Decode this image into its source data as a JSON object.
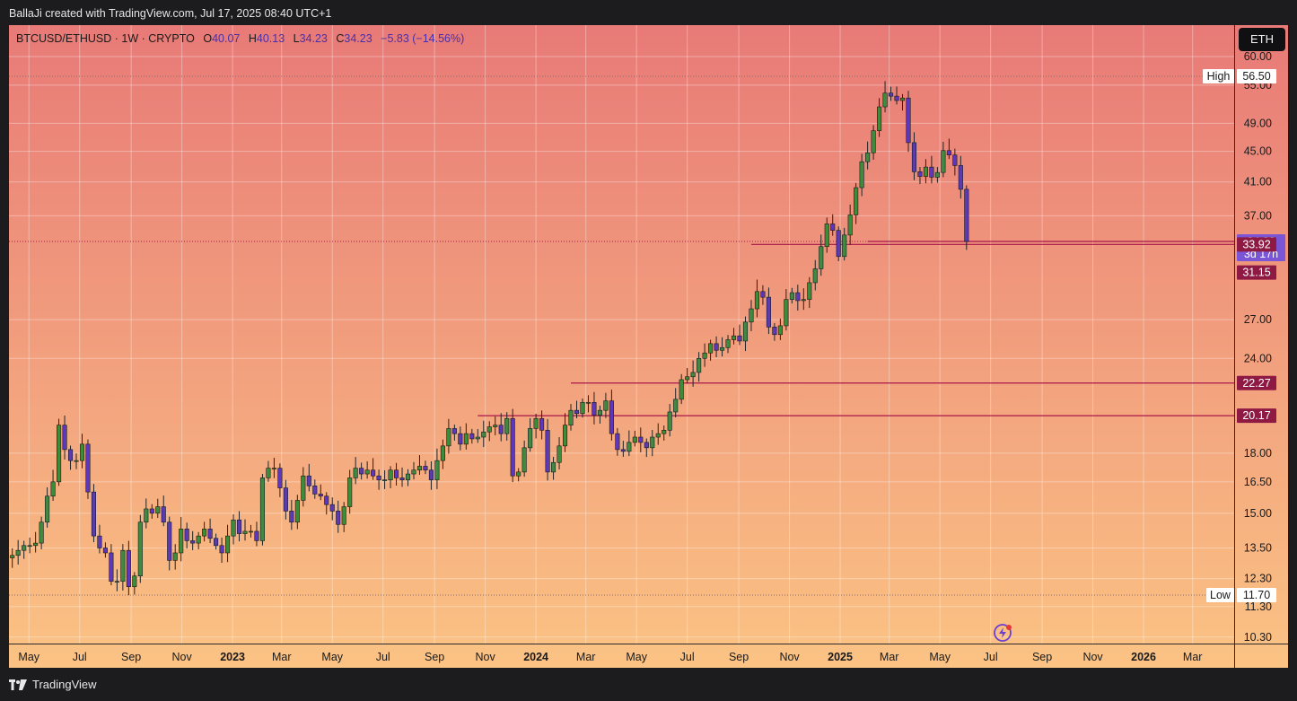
{
  "header": {
    "credit": "BallaJi created with TradingView.com, Jul 17, 2025 08:40 UTC+1"
  },
  "legend": {
    "symbol": "BTCUSD/ETHUSD · 1W · CRYPTO",
    "o_label": "O",
    "o_value": "40.07",
    "h_label": "H",
    "h_value": "40.13",
    "l_label": "L",
    "l_value": "34.23",
    "c_label": "C",
    "c_value": "34.23",
    "change": "−5.83 (−14.56%)"
  },
  "symbol_badge": "ETH",
  "footer": {
    "brand": "TradingView"
  },
  "colors": {
    "bg_top": "#e87a77",
    "bg_bottom": "#fbc384",
    "up": "#3e8b3e",
    "down": "#5d38b8",
    "level": "#a8164a",
    "price_label": "#7a56d6",
    "level_label": "#8e1a44"
  },
  "chart_data": {
    "type": "candlestick",
    "scale": "log",
    "ylim": [
      10.1,
      66
    ],
    "x_range": [
      "2022-04-07",
      "2026-04-20"
    ],
    "x_ticks": [
      {
        "date": "2022-05-01",
        "label": "May",
        "bold": false
      },
      {
        "date": "2022-07-01",
        "label": "Jul",
        "bold": false
      },
      {
        "date": "2022-09-01",
        "label": "Sep",
        "bold": false
      },
      {
        "date": "2022-11-01",
        "label": "Nov",
        "bold": false
      },
      {
        "date": "2023-01-01",
        "label": "2023",
        "bold": true
      },
      {
        "date": "2023-03-01",
        "label": "Mar",
        "bold": false
      },
      {
        "date": "2023-05-01",
        "label": "May",
        "bold": false
      },
      {
        "date": "2023-07-01",
        "label": "Jul",
        "bold": false
      },
      {
        "date": "2023-09-01",
        "label": "Sep",
        "bold": false
      },
      {
        "date": "2023-11-01",
        "label": "Nov",
        "bold": false
      },
      {
        "date": "2024-01-01",
        "label": "2024",
        "bold": true
      },
      {
        "date": "2024-03-01",
        "label": "Mar",
        "bold": false
      },
      {
        "date": "2024-05-01",
        "label": "May",
        "bold": false
      },
      {
        "date": "2024-07-01",
        "label": "Jul",
        "bold": false
      },
      {
        "date": "2024-09-01",
        "label": "Sep",
        "bold": false
      },
      {
        "date": "2024-11-01",
        "label": "Nov",
        "bold": false
      },
      {
        "date": "2025-01-01",
        "label": "2025",
        "bold": true
      },
      {
        "date": "2025-03-01",
        "label": "Mar",
        "bold": false
      },
      {
        "date": "2025-05-01",
        "label": "May",
        "bold": false
      },
      {
        "date": "2025-07-01",
        "label": "Jul",
        "bold": false
      },
      {
        "date": "2025-09-01",
        "label": "Sep",
        "bold": false
      },
      {
        "date": "2025-11-01",
        "label": "Nov",
        "bold": false
      },
      {
        "date": "2026-01-01",
        "label": "2026",
        "bold": true
      },
      {
        "date": "2026-03-01",
        "label": "Mar",
        "bold": false
      }
    ],
    "y_ticks": [
      "60.00",
      "55.00",
      "49.00",
      "45.00",
      "41.00",
      "37.00",
      "27.00",
      "24.00",
      "18.00",
      "16.50",
      "15.00",
      "13.50",
      "12.30",
      "11.30",
      "10.30"
    ],
    "high": {
      "label": "High",
      "value": "56.50"
    },
    "low": {
      "label": "Low",
      "value": "11.70"
    },
    "last": {
      "value": "34.23",
      "countdown": "3d 17h"
    },
    "levels": [
      {
        "value": "33.92",
        "from": "2024-09-16"
      },
      {
        "value": "31.15",
        "from": null
      },
      {
        "value": "22.27",
        "from": "2024-02-12"
      },
      {
        "value": "20.17",
        "from": "2023-10-23"
      }
    ],
    "candle_start": "2022-04-04",
    "closes": [
      13.1,
      13.2,
      13.4,
      13.6,
      13.6,
      13.7,
      14.6,
      15.8,
      16.5,
      19.6,
      18.2,
      17.6,
      17.6,
      18.5,
      16.0,
      14.0,
      13.5,
      13.3,
      12.2,
      12.2,
      13.4,
      12.0,
      12.4,
      14.6,
      15.2,
      15.0,
      15.3,
      14.6,
      13.0,
      13.3,
      14.3,
      13.8,
      13.7,
      14.0,
      14.3,
      13.9,
      13.6,
      13.3,
      14.0,
      14.7,
      14.1,
      14.2,
      14.2,
      13.8,
      16.7,
      17.2,
      17.2,
      16.2,
      15.1,
      14.6,
      15.6,
      16.8,
      16.3,
      15.9,
      15.8,
      15.4,
      15.1,
      14.5,
      15.3,
      16.7,
      17.2,
      16.9,
      17.1,
      16.8,
      16.6,
      16.6,
      17.1,
      16.7,
      16.6,
      16.9,
      17.1,
      17.3,
      17.1,
      16.6,
      17.6,
      18.4,
      19.4,
      19.1,
      18.5,
      19.1,
      18.8,
      18.9,
      19.2,
      19.5,
      19.6,
      19.1,
      20.0,
      16.8,
      17.0,
      18.3,
      19.4,
      20.0,
      19.3,
      17.0,
      17.5,
      18.4,
      19.6,
      20.5,
      20.3,
      21.0,
      21.0,
      20.2,
      20.5,
      21.1,
      19.1,
      18.2,
      18.1,
      18.6,
      18.9,
      18.6,
      18.3,
      18.9,
      19.1,
      19.3,
      20.4,
      21.2,
      22.5,
      22.7,
      23.0,
      24.0,
      24.4,
      25.1,
      24.6,
      24.8,
      25.4,
      25.7,
      25.3,
      26.8,
      27.9,
      29.4,
      28.9,
      26.4,
      25.8,
      26.5,
      28.7,
      29.3,
      28.6,
      28.7,
      30.2,
      31.5,
      33.7,
      36.1,
      35.4,
      32.7,
      34.9,
      37.1,
      40.3,
      43.6,
      44.8,
      47.9,
      51.5,
      53.7,
      53.2,
      52.5,
      52.9,
      46.2,
      42.3,
      41.7,
      42.9,
      41.6,
      42.2,
      45.1,
      44.5,
      43.1,
      40.1,
      34.23
    ]
  }
}
